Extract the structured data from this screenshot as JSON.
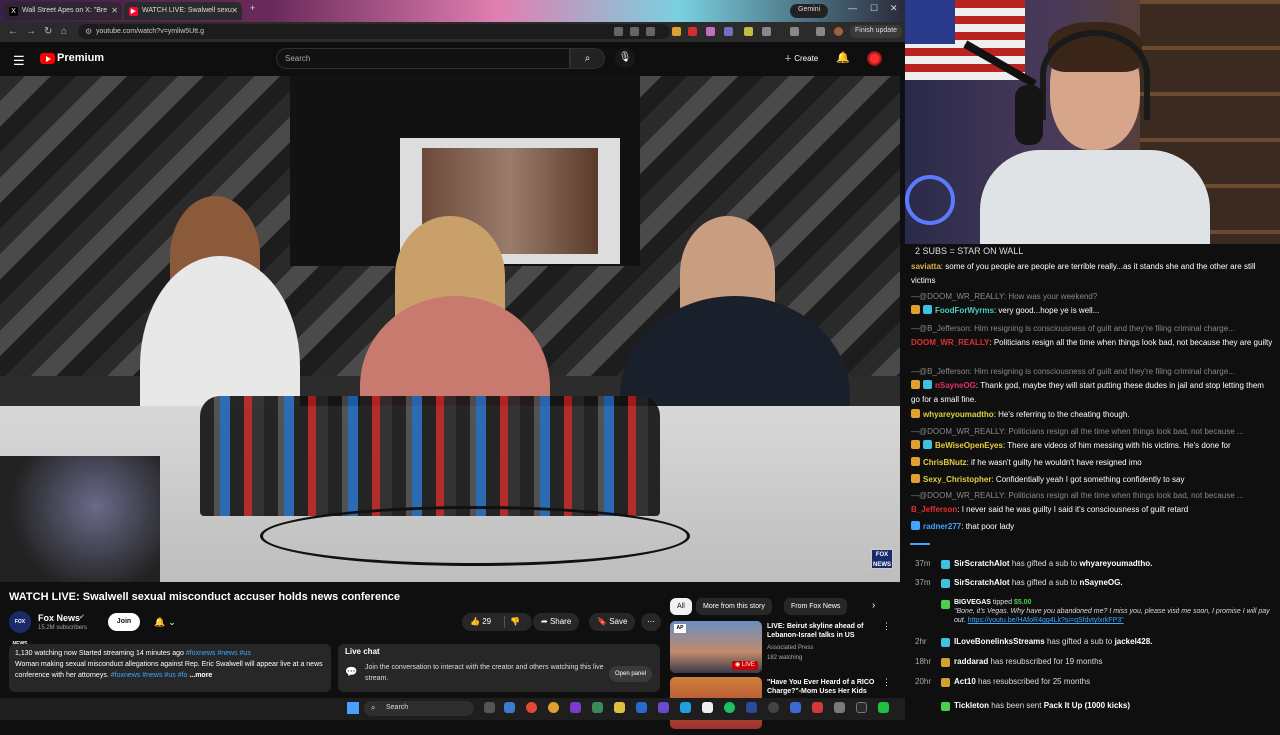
{
  "browser": {
    "tabs": [
      {
        "label": "Wall Street Apes on X: \"Bre",
        "active": false
      },
      {
        "label": "WATCH LIVE: Swalwell sexu",
        "active": true
      }
    ],
    "gemini_label": "Gemini",
    "url": "youtube.com/watch?v=ymliw5Utt.g",
    "finish_update_label": "Finish update"
  },
  "youtube_header": {
    "brand": "Premium",
    "search_placeholder": "Search",
    "create_label": "Create"
  },
  "video": {
    "network_bug": "FOX NEWS"
  },
  "watch": {
    "title": "WATCH LIVE: Swalwell sexual misconduct accuser holds news conference",
    "channel": {
      "avatar_text": "FOX NEWS",
      "name": "Fox News",
      "subscribers": "15.2M subscribers",
      "join_label": "Join"
    },
    "actions": {
      "likes": "29",
      "share_label": "Share",
      "save_label": "Save"
    },
    "description": {
      "stats": "1,130 watching now  Started streaming 14 minutes ago",
      "tags": "#foxnews #news #us",
      "text": "Woman making sexual misconduct allegations against Rep. Eric Swalwell will appear live at a news conference with her attorneys.",
      "text_tags": "#foxnews #news #us #fo",
      "more_label": "...more"
    },
    "live_chat": {
      "title": "Live chat",
      "text": "Join the conversation to interact with the creator and others watching this live stream.",
      "open_label": "Open panel"
    }
  },
  "recommendations": {
    "chips": [
      "All",
      "More from this story",
      "From Fox News"
    ],
    "items": [
      {
        "badge": "AP",
        "title": "LIVE: Beirut skyline ahead of Lebanon-Israel talks in US",
        "channel": "Associated Press",
        "views": "182 watching",
        "live_label": "LIVE"
      },
      {
        "title": "\"Have You Ever Heard of a RICO Charge?\"-Mom Uses Her Kids",
        "channel": "",
        "views": ""
      }
    ]
  },
  "taskbar": {
    "search_label": "Search"
  },
  "stream_overlay": {
    "banner": "2 SUBS = STAR ON WALL"
  },
  "chat": {
    "messages": [
      {
        "user": "saviatta",
        "text": "some of you people are people are terrible really...as it stands she and the other are still victims",
        "color": "#d4b04a",
        "faded": false
      },
      {
        "user": "",
        "text": "—@DOOM_WR_REALLY: How was your weekend?",
        "faded": true
      },
      {
        "user": "FoodForWyrms",
        "text": "very good...hope ye is well...",
        "color": "#4ad0c0",
        "faded": false
      },
      {
        "user": "",
        "text": "—@B_Jefferson: Him resigning is consciousness of guilt and they're filing criminal charge...",
        "faded": true
      },
      {
        "user": "DOOM_WR_REALLY",
        "text": "Politicians resign all the time when things look bad, not because they are guilty",
        "color": "#e03030",
        "faded": false
      },
      {
        "user": "",
        "text": "—@B_Jefferson: Him resigning is consciousness of guilt and they're filing criminal charge...",
        "faded": true
      },
      {
        "user": "nSayneOG",
        "text": "Thank god, maybe they will start putting these dudes in jail and stop letting them go for a small fine.",
        "color": "#e03060",
        "faded": false
      },
      {
        "user": "whyareyoumadtho",
        "text": "He's referring to the cheating though.",
        "color": "#e0d040",
        "faded": false
      },
      {
        "user": "",
        "text": "—@DOOM_WR_REALLY: Politicians resign all the time when things look bad, not because ...",
        "faded": true
      },
      {
        "user": "BeWiseOpenEyes",
        "text": "There are videos of him messing with his victims. He's done for",
        "color": "#e0d040",
        "faded": false
      },
      {
        "user": "ChrisBNutz",
        "text": "if he wasn't guilty he wouldn't have resigned imo",
        "color": "#e0d040",
        "faded": false
      },
      {
        "user": "Sexy_Christopher",
        "text": "Confidentially yeah I got something confidently to say",
        "color": "#e0d040",
        "faded": false
      },
      {
        "user": "",
        "text": "—@DOOM_WR_REALLY: Politicians resign all the time when things look bad, not because ...",
        "faded": true
      },
      {
        "user": "B_Jefferson",
        "text": "I never said he was guilty I said it's consciousness of guilt retard",
        "color": "#e03030",
        "faded": false
      },
      {
        "user": "radner277",
        "text": "that poor lady",
        "color": "#3ea6ff",
        "faded": false
      }
    ],
    "events": [
      {
        "time": "37m",
        "name": "SirScratchAlot",
        "text": "has gifted a sub to",
        "target": "whyareyoumadtho."
      },
      {
        "time": "37m",
        "name": "SirScratchAlot",
        "text": "has gifted a sub to",
        "target": "nSayneOG."
      },
      {
        "time": "",
        "name": "BIGVEGAS",
        "text": "tipped",
        "amount": "$5.00",
        "message": "\"Bone, it's Vegas. Why have you abandoned me? I miss you, please visit me soon, I promise I will pay out.",
        "link": "https://youtu.be/HAfoR4gg4Lk?si=qSfdvtylxrkFP3\""
      },
      {
        "time": "2hr",
        "name": "ILoveBonelinksStreams",
        "text": "has gifted a sub to",
        "target": "jackel428."
      },
      {
        "time": "18hr",
        "name": "raddarad",
        "text": "has resubscribed for 19 months"
      },
      {
        "time": "20hr",
        "name": "Act10",
        "text": "has resubscribed for 25 months"
      },
      {
        "time": "",
        "name": "Tickleton",
        "text": "has been sent",
        "target": "Pack It Up (1000 kicks)"
      }
    ]
  },
  "colors": {
    "youtube_red": "#ff0000",
    "link_blue": "#3ea6ff",
    "background": "#0f0f0f"
  }
}
